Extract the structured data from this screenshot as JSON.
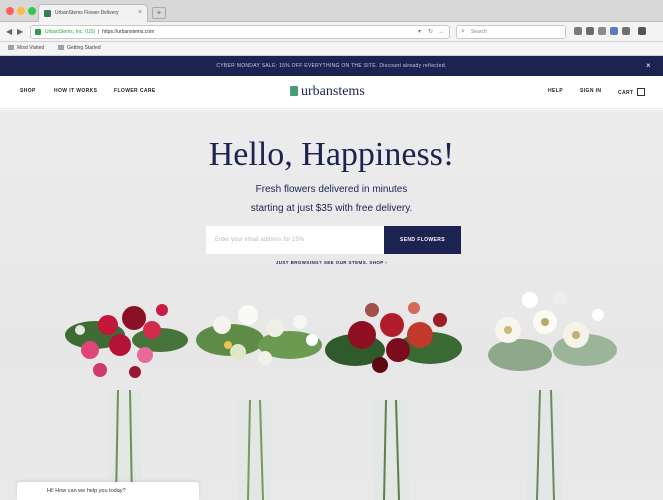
{
  "browser": {
    "tab_title": "UrbanStems Flower Delivery",
    "tab_close": "×",
    "new_tab": "+",
    "url_secure_label": "UrbanStems, Inc. (US)",
    "url": "https://urbanstems.com",
    "search_placeholder": "Search",
    "bookmarks": [
      "Most Visited",
      "Getting Started"
    ],
    "nav": {
      "back": "◀",
      "forward": "▶",
      "reload": "↻"
    }
  },
  "promo": {
    "text": "CYBER MONDAY SALE: 15% OFF EVERYTHING ON THE SITE. Discount already reflected.",
    "close": "×"
  },
  "header": {
    "nav_left": [
      "SHOP",
      "HOW IT WORKS",
      "FLOWER CARE"
    ],
    "logo": "urbanstems",
    "nav_right": [
      "HELP",
      "SIGN IN",
      "CART"
    ]
  },
  "hero": {
    "headline": "Hello, Happiness!",
    "sub_line1": "Fresh flowers delivered in minutes",
    "sub_line2": "starting at just $35 with free delivery.",
    "email_placeholder": "Enter your email address for 15%",
    "send_button": "SEND FLOWERS",
    "small_link": "JUST BROWSING? SEE OUR STEMS. SHOP ›"
  },
  "chat": {
    "text": "Hi! How can we help you today?"
  },
  "colors": {
    "brand_navy": "#1d2351",
    "brand_green": "#4a9c78"
  }
}
